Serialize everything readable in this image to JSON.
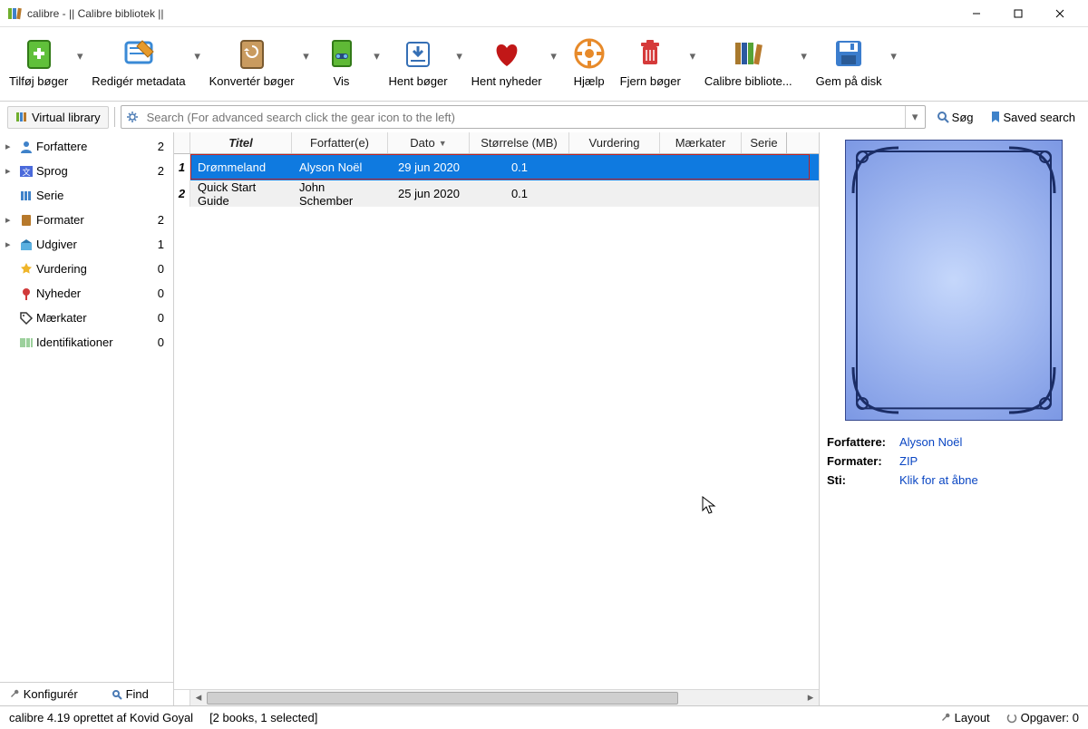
{
  "window": {
    "title": "calibre - || Calibre bibliotek ||"
  },
  "toolbar": [
    {
      "id": "add",
      "label": "Tilføj bøger",
      "drop": true
    },
    {
      "id": "edit",
      "label": "Redigér metadata",
      "drop": true
    },
    {
      "id": "convert",
      "label": "Konvertér bøger",
      "drop": true
    },
    {
      "id": "view",
      "label": "Vis",
      "drop": true
    },
    {
      "id": "fetch",
      "label": "Hent bøger",
      "drop": true
    },
    {
      "id": "news",
      "label": "Hent nyheder",
      "drop": true
    },
    {
      "id": "help",
      "label": "Hjælp",
      "drop": true
    },
    {
      "id": "remove",
      "label": "Fjern bøger",
      "drop": true
    },
    {
      "id": "library",
      "label": "Calibre bibliote...",
      "drop": true
    },
    {
      "id": "save",
      "label": "Gem på disk",
      "drop": true
    }
  ],
  "search": {
    "virtual_library": "Virtual library",
    "placeholder": "Search (For advanced search click the gear icon to the left)",
    "search_label": "Søg",
    "saved_search_label": "Saved search"
  },
  "sidebar": {
    "items": [
      {
        "expand": true,
        "icon": "person",
        "label": "Forfattere",
        "count": "2"
      },
      {
        "expand": true,
        "icon": "lang",
        "label": "Sprog",
        "count": "2"
      },
      {
        "expand": false,
        "icon": "series",
        "label": "Serie",
        "count": ""
      },
      {
        "expand": true,
        "icon": "book",
        "label": "Formater",
        "count": "2"
      },
      {
        "expand": true,
        "icon": "publisher",
        "label": "Udgiver",
        "count": "1"
      },
      {
        "expand": false,
        "icon": "star",
        "label": "Vurdering",
        "count": "0"
      },
      {
        "expand": false,
        "icon": "news",
        "label": "Nyheder",
        "count": "0"
      },
      {
        "expand": false,
        "icon": "tag",
        "label": "Mærkater",
        "count": "0"
      },
      {
        "expand": false,
        "icon": "id",
        "label": "Identifikationer",
        "count": "0"
      }
    ],
    "footer": {
      "configure": "Konfigurér",
      "find": "Find"
    }
  },
  "table": {
    "headers": {
      "title": "Titel",
      "author": "Forfatter(e)",
      "date": "Dato",
      "size": "Størrelse (MB)",
      "rating": "Vurdering",
      "tags": "Mærkater",
      "series": "Serie"
    },
    "rows": [
      {
        "n": "1",
        "title": "Drømmeland",
        "author": "Alyson Noël",
        "date": "29 jun 2020",
        "size": "0.1",
        "selected": true
      },
      {
        "n": "2",
        "title": "Quick Start Guide",
        "author": "John Schember",
        "date": "25 jun 2020",
        "size": "0.1",
        "selected": false
      }
    ]
  },
  "details": {
    "forfattere_label": "Forfattere:",
    "forfattere_value": "Alyson Noël",
    "formater_label": "Formater:",
    "formater_value": "ZIP",
    "sti_label": "Sti:",
    "sti_value": "Klik for at åbne"
  },
  "statusbar": {
    "version": "calibre 4.19 oprettet af Kovid Goyal",
    "selection": "[2 books, 1 selected]",
    "layout": "Layout",
    "jobs": "Opgaver: 0"
  }
}
